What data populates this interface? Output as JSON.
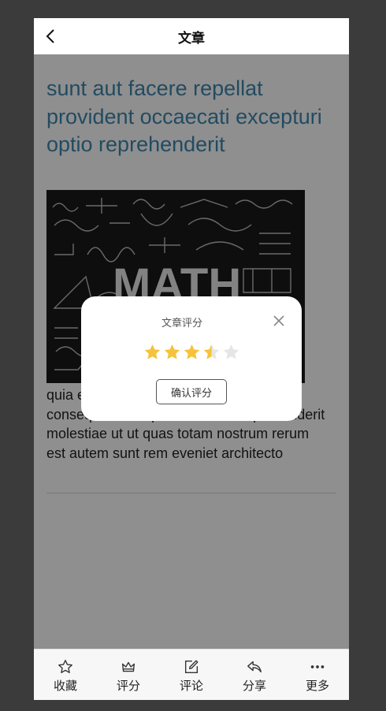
{
  "header": {
    "title": "文章"
  },
  "article": {
    "title": "sunt aut facere repellat provident occaecati excepturi optio reprehenderit",
    "image_text": "MATH",
    "body": "quia et suscipit suscipit recusandae consequuntur expedita et cum reprehenderit molestiae ut ut quas totam nostrum rerum est autem sunt rem eveniet architecto"
  },
  "modal": {
    "title": "文章评分",
    "rating": 3.5,
    "max": 5,
    "confirm_label": "确认评分"
  },
  "tabbar": [
    {
      "label": "收藏",
      "icon": "star-outline-icon"
    },
    {
      "label": "评分",
      "icon": "crown-icon"
    },
    {
      "label": "评论",
      "icon": "edit-icon"
    },
    {
      "label": "分享",
      "icon": "share-icon"
    },
    {
      "label": "更多",
      "icon": "more-icon"
    }
  ],
  "colors": {
    "title_blue": "#3d86ad",
    "star_yellow": "#f5c33b",
    "star_empty": "#e6e6e6"
  }
}
